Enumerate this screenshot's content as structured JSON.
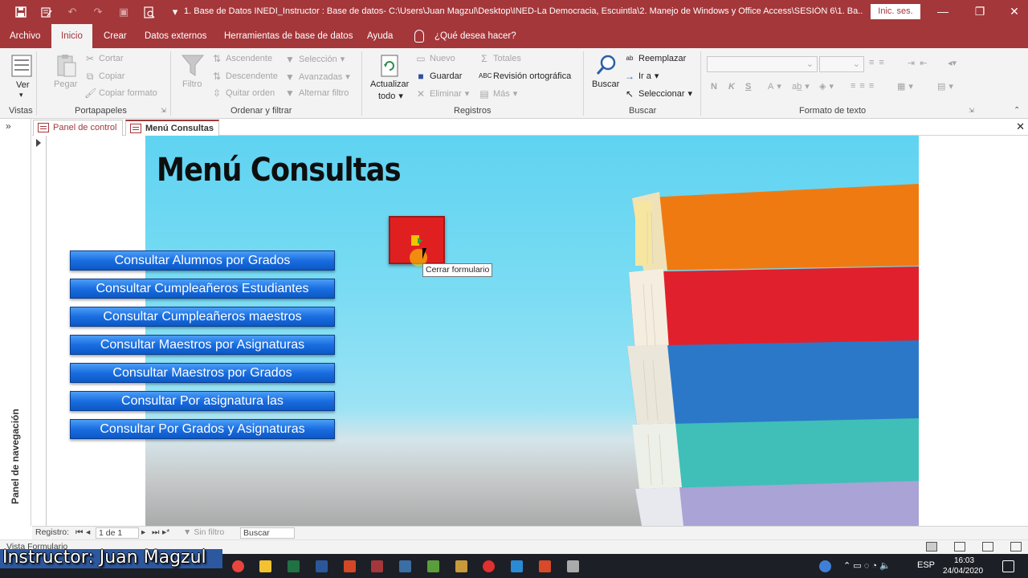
{
  "window": {
    "title": "1. Base de Datos INEDI_Instructor : Base de datos- C:\\Users\\Juan Magzul\\Desktop\\INED-La Democracia, Escuintla\\2. Manejo de Windows y Office Access\\SESIÓN 6\\1. Ba...",
    "signin_label": "Inic. ses.",
    "accent": "#a4373a"
  },
  "ribbon_tabs": [
    "Archivo",
    "Inicio",
    "Crear",
    "Datos externos",
    "Herramientas de base de datos",
    "Ayuda"
  ],
  "tell_me": "¿Qué desea hacer?",
  "ribbon": {
    "vistas": {
      "ver": "Ver",
      "label": "Vistas"
    },
    "portapapeles": {
      "pegar": "Pegar",
      "cortar": "Cortar",
      "copiar": "Copiar",
      "copiar_formato": "Copiar formato",
      "label": "Portapapeles"
    },
    "ordenar": {
      "filtro": "Filtro",
      "ascendente": "Ascendente",
      "descendente": "Descendente",
      "quitar_orden": "Quitar orden",
      "seleccion": "Selección",
      "avanzadas": "Avanzadas",
      "alternar_filtro": "Alternar filtro",
      "label": "Ordenar y filtrar"
    },
    "registros": {
      "actualizar": "Actualizar",
      "todo": "todo",
      "nuevo": "Nuevo",
      "guardar": "Guardar",
      "eliminar": "Eliminar",
      "totales": "Totales",
      "revision": "Revisión ortográfica",
      "mas": "Más",
      "label": "Registros"
    },
    "buscar": {
      "buscar": "Buscar",
      "reemplazar": "Reemplazar",
      "ir_a": "Ir a",
      "seleccionar": "Seleccionar",
      "label": "Buscar"
    },
    "formato": {
      "bold": "N",
      "italic": "K",
      "underline": "S",
      "label": "Formato de texto"
    }
  },
  "doc_tabs": [
    "Panel de control",
    "Menú Consultas"
  ],
  "nav_pane_label": "Panel de navegación",
  "form": {
    "title": "Menú Consultas",
    "buttons": [
      "Consultar Alumnos por Grados",
      "Consultar Cumpleañeros Estudiantes",
      "Consultar Cumpleañeros maestros",
      "Consultar Maestros por Asignaturas",
      "Consultar Maestros por Grados",
      "Consultar Por asignatura las",
      "Consultar Por Grados y Asignaturas"
    ],
    "close_tooltip": "Cerrar formulario"
  },
  "record_nav": {
    "label": "Registro:",
    "position": "1 de 1",
    "filter": "Sin filtro",
    "search": "Buscar"
  },
  "status": {
    "view": "Vista Formulario"
  },
  "watermark": "Instructor: Juan Magzul",
  "taskbar": {
    "lang": "ESP",
    "time": "16:03",
    "date": "24/04/2020"
  }
}
